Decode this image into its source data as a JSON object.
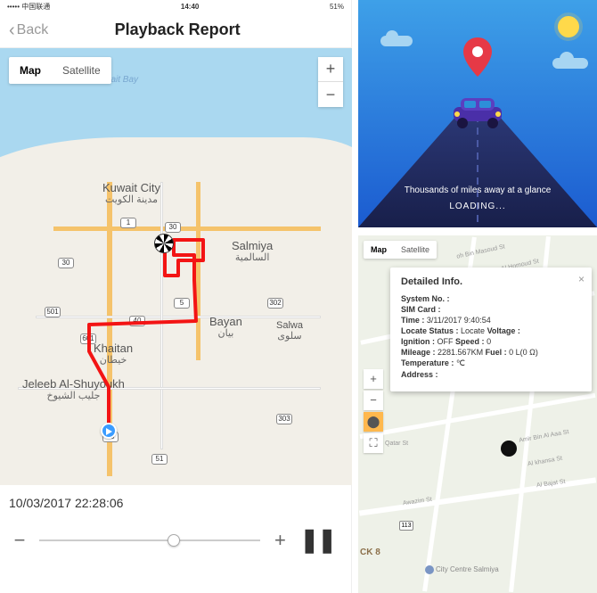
{
  "left": {
    "statusbar": {
      "carrier": "••••• 中国联通",
      "time": "14:40",
      "battery": "51%"
    },
    "nav": {
      "back": "Back",
      "title": "Playback Report"
    },
    "map": {
      "type_map": "Map",
      "type_sat": "Satellite",
      "zoom_in": "+",
      "zoom_out": "−",
      "water_label": "Kuwait Bay",
      "cities": {
        "kuwait_city": "Kuwait City",
        "kuwait_city_ar": "مدينة الكويت",
        "salmiya": "Salmiya",
        "salmiya_ar": "السالمية",
        "bayan": "Bayan",
        "bayan_ar": "بيان",
        "khaitan": "Khaitan",
        "khaitan_ar": "خيطان",
        "jeleeb": "Jeleeb Al-Shuyoukh",
        "jeleeb_ar": "جليب الشيوخ",
        "salwa": "Salwa",
        "salwa_ar": "سلوى"
      },
      "shields": {
        "r1": "1",
        "r30a": "30",
        "r30b": "30",
        "r5": "5",
        "r40a": "40",
        "r302": "302",
        "r601": "601",
        "r501": "501",
        "r303": "303",
        "r50": "50",
        "r51": "51"
      }
    },
    "timestamp": "10/03/2017 22:28:06",
    "player": {
      "minus": "−",
      "plus": "+",
      "pause": "❚❚"
    }
  },
  "splash": {
    "tagline": "Thousands of miles away at a glance",
    "loading": "LOADING..."
  },
  "detail": {
    "type_map": "Map",
    "type_sat": "Satellite",
    "zoom_in": "+",
    "zoom_out": "−",
    "popup": {
      "title": "Detailed Info.",
      "system_no_k": "System No. :",
      "system_no_v": "",
      "sim_k": "SIM Card :",
      "sim_v": "",
      "time_k": "Time :",
      "time_v": "3/11/2017 9:40:54",
      "locate_k": "Locate Status :",
      "locate_v": "Locate",
      "voltage_k": "Voltage :",
      "voltage_v": "",
      "ignition_k": "Ignition :",
      "ignition_v": "OFF",
      "speed_k": "Speed :",
      "speed_v": "0",
      "mileage_k": "Mileage :",
      "mileage_v": "2281.567KM",
      "fuel_k": "Fuel :",
      "fuel_v": "0 L(0 Ω)",
      "temp_k": "Temperature :",
      "temp_v": "℃",
      "addr_k": "Address :",
      "addr_v": ""
    },
    "streets": {
      "masoud": "oh Bin Masoud St",
      "homoud": "Al Homoud St",
      "aaa": "Amir Bin Al Aaa St",
      "khansa": "Al khansa St",
      "awazim": "Awazim St",
      "bajat": "Al Bajat St",
      "qatar": "Qatar St"
    },
    "poi_city_centre": "City Centre Salmiya",
    "route_shield": "113",
    "block_label": "CK 8"
  }
}
